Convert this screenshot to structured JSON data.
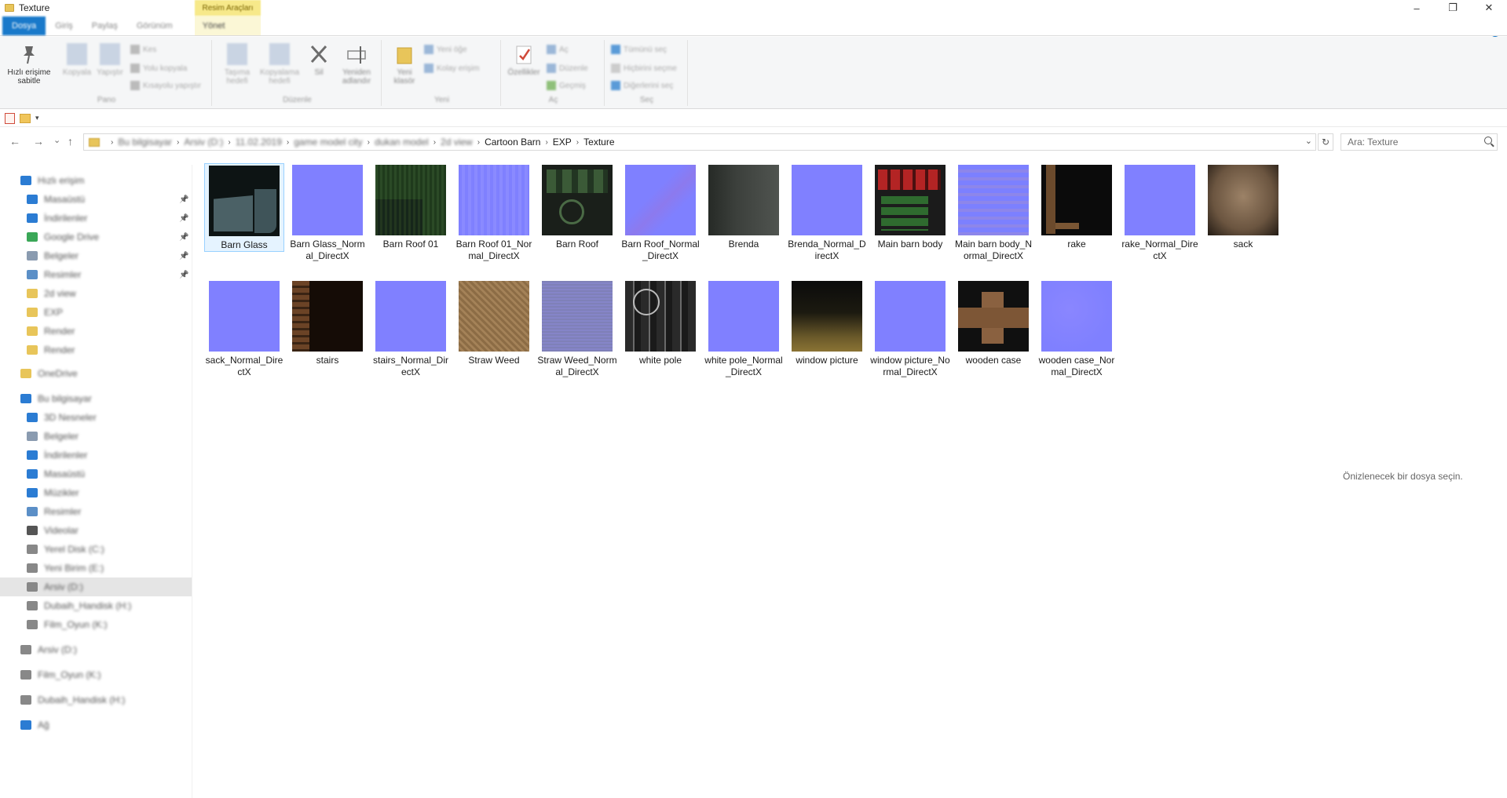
{
  "window": {
    "title": "Texture",
    "minimize": "–",
    "maximize": "❐",
    "close": "✕"
  },
  "ribbon": {
    "tools_context": "Resim Araçları",
    "tabs": [
      "Dosya",
      "Giriş",
      "Paylaş",
      "Görünüm",
      "Yönet"
    ],
    "expand_chevron": "⌃",
    "help": "?",
    "clipboard": {
      "pin_label": "Hızlı erişime sabitle",
      "copy_label": "Kopyala",
      "paste_label": "Yapıştır",
      "cut_label": "Kes",
      "copy_path_label": "Yolu kopyala",
      "paste_shortcut_label": "Kısayolu yapıştır",
      "group_label": "Pano"
    },
    "organize": {
      "move_label": "Taşıma hedefi",
      "copy_to_label": "Kopyalama hedefi",
      "delete_label": "Sil",
      "rename_label": "Yeniden adlandır",
      "group_label": "Düzenle"
    },
    "new": {
      "new_folder_label": "Yeni klasör",
      "new_item_label": "Yeni öğe",
      "easy_access_label": "Kolay erişim",
      "group_label": "Yeni"
    },
    "open": {
      "properties_label": "Özellikler",
      "open_label": "Aç",
      "edit_label": "Düzenle",
      "history_label": "Geçmiş",
      "group_label": "Aç"
    },
    "select": {
      "select_all_label": "Tümünü seç",
      "select_none_label": "Hiçbirini seçme",
      "invert_label": "Diğerlerini seç",
      "group_label": "Seç"
    }
  },
  "qat": {
    "dropdown": "▾"
  },
  "nav": {
    "back": "←",
    "forward": "→",
    "recent": "⌄",
    "up": "↑",
    "breadcrumb": [
      {
        "label": "Bu bilgisayar",
        "blurred": true
      },
      {
        "label": "Arsiv (D:)",
        "blurred": true
      },
      {
        "label": "11.02.2019",
        "blurred": true
      },
      {
        "label": "game model city",
        "blurred": true
      },
      {
        "label": "dukan model",
        "blurred": true
      },
      {
        "label": "2d view",
        "blurred": true
      },
      {
        "label": "Cartoon Barn",
        "blurred": false
      },
      {
        "label": "EXP",
        "blurred": false
      },
      {
        "label": "Texture",
        "blurred": false
      }
    ],
    "history_dropdown": "⌄",
    "refresh": "↻",
    "search_placeholder": "Ara: Texture"
  },
  "sidebar": {
    "items": [
      {
        "label": "Hızlı erişim",
        "icon": "star-icon",
        "color": "#2b7cd3",
        "pinned": false,
        "indent": 1
      },
      {
        "label": "Masaüstü",
        "icon": "desktop-icon",
        "color": "#2b7cd3",
        "pinned": true,
        "indent": 2
      },
      {
        "label": "İndirilenler",
        "icon": "download-icon",
        "color": "#2b7cd3",
        "pinned": true,
        "indent": 2
      },
      {
        "label": "Google Drive",
        "icon": "drive-icon",
        "color": "#3aa757",
        "pinned": true,
        "indent": 2
      },
      {
        "label": "Belgeler",
        "icon": "document-icon",
        "color": "#8a9bb0",
        "pinned": true,
        "indent": 2
      },
      {
        "label": "Resimler",
        "icon": "picture-icon",
        "color": "#5b8fc7",
        "pinned": true,
        "indent": 2
      },
      {
        "label": "2d view",
        "icon": "folder-icon",
        "color": "#e8c55a",
        "pinned": false,
        "indent": 2
      },
      {
        "label": "EXP",
        "icon": "folder-icon",
        "color": "#e8c55a",
        "pinned": false,
        "indent": 2
      },
      {
        "label": "Render",
        "icon": "folder-icon",
        "color": "#e8c55a",
        "pinned": false,
        "indent": 2
      },
      {
        "label": "Render",
        "icon": "folder-icon",
        "color": "#e8c55a",
        "pinned": false,
        "indent": 2
      },
      {
        "label": "OneDrive",
        "icon": "cloud-icon",
        "color": "#e8c55a",
        "pinned": false,
        "indent": 1
      },
      {
        "label": "Bu bilgisayar",
        "icon": "computer-icon",
        "color": "#2b7cd3",
        "pinned": false,
        "indent": 1
      },
      {
        "label": "3D Nesneler",
        "icon": "cube-icon",
        "color": "#2b7cd3",
        "pinned": false,
        "indent": 2
      },
      {
        "label": "Belgeler",
        "icon": "document-icon",
        "color": "#8a9bb0",
        "pinned": false,
        "indent": 2
      },
      {
        "label": "İndirilenler",
        "icon": "download-icon",
        "color": "#2b7cd3",
        "pinned": false,
        "indent": 2
      },
      {
        "label": "Masaüstü",
        "icon": "desktop-icon",
        "color": "#2b7cd3",
        "pinned": false,
        "indent": 2
      },
      {
        "label": "Müzikler",
        "icon": "music-icon",
        "color": "#2b7cd3",
        "pinned": false,
        "indent": 2
      },
      {
        "label": "Resimler",
        "icon": "picture-icon",
        "color": "#5b8fc7",
        "pinned": false,
        "indent": 2
      },
      {
        "label": "Videolar",
        "icon": "video-icon",
        "color": "#555555",
        "pinned": false,
        "indent": 2
      },
      {
        "label": "Yerel Disk (C:)",
        "icon": "drive-icon",
        "color": "#888888",
        "pinned": false,
        "indent": 2
      },
      {
        "label": "Yeni Birim (E:)",
        "icon": "drive-icon",
        "color": "#888888",
        "pinned": false,
        "indent": 2
      },
      {
        "label": "Arsiv (D:)",
        "icon": "drive-icon",
        "color": "#888888",
        "pinned": false,
        "indent": 2,
        "selected": true
      },
      {
        "label": "Dubaih_Handisk (H:)",
        "icon": "drive-icon",
        "color": "#888888",
        "pinned": false,
        "indent": 2
      },
      {
        "label": "Film_Oyun (K:)",
        "icon": "drive-icon",
        "color": "#888888",
        "pinned": false,
        "indent": 2
      },
      {
        "label": "Arsiv (D:)",
        "icon": "drive-icon",
        "color": "#888888",
        "pinned": false,
        "indent": 1
      },
      {
        "label": "Film_Oyun (K:)",
        "icon": "drive-icon",
        "color": "#888888",
        "pinned": false,
        "indent": 1
      },
      {
        "label": "Dubaih_Handisk (H:)",
        "icon": "drive-icon",
        "color": "#888888",
        "pinned": false,
        "indent": 1
      },
      {
        "label": "Ağ",
        "icon": "network-icon",
        "color": "#2b7cd3",
        "pinned": false,
        "indent": 1
      }
    ]
  },
  "files": [
    {
      "name": "Barn Glass",
      "thumb": "t-barnglass",
      "selected": true
    },
    {
      "name": "Barn Glass_Normal_DirectX",
      "thumb": "t-normal"
    },
    {
      "name": "Barn Roof 01",
      "thumb": "t-roof"
    },
    {
      "name": "Barn Roof 01_Normal_DirectX",
      "thumb": "t-roofn"
    },
    {
      "name": "Barn Roof",
      "thumb": "t-barnroof"
    },
    {
      "name": "Barn Roof_Normal_DirectX",
      "thumb": "t-barnroofn"
    },
    {
      "name": "Brenda",
      "thumb": "t-brenda"
    },
    {
      "name": "Brenda_Normal_DirectX",
      "thumb": "t-normal"
    },
    {
      "name": "Main barn body",
      "thumb": "t-mainbody"
    },
    {
      "name": "Main barn body_Normal_DirectX",
      "thumb": "t-mainbodyn"
    },
    {
      "name": "rake",
      "thumb": "t-rake"
    },
    {
      "name": "rake_Normal_DirectX",
      "thumb": "t-normal"
    },
    {
      "name": "sack",
      "thumb": "t-sack"
    },
    {
      "name": "sack_Normal_DirectX",
      "thumb": "t-normal"
    },
    {
      "name": "stairs",
      "thumb": "t-stairs"
    },
    {
      "name": "stairs_Normal_DirectX",
      "thumb": "t-normal"
    },
    {
      "name": "Straw Weed",
      "thumb": "t-straw"
    },
    {
      "name": "Straw Weed_Normal_DirectX",
      "thumb": "t-strawn"
    },
    {
      "name": "white pole",
      "thumb": "t-whitepole"
    },
    {
      "name": "white pole_Normal_DirectX",
      "thumb": "t-normal"
    },
    {
      "name": "window picture",
      "thumb": "t-window"
    },
    {
      "name": "window picture_Normal_DirectX",
      "thumb": "t-normal"
    },
    {
      "name": "wooden case",
      "thumb": "t-wooden"
    },
    {
      "name": "wooden case_Normal_DirectX",
      "thumb": "t-woodenn"
    }
  ],
  "preview": {
    "message": "Önizlenecek bir dosya seçin."
  }
}
